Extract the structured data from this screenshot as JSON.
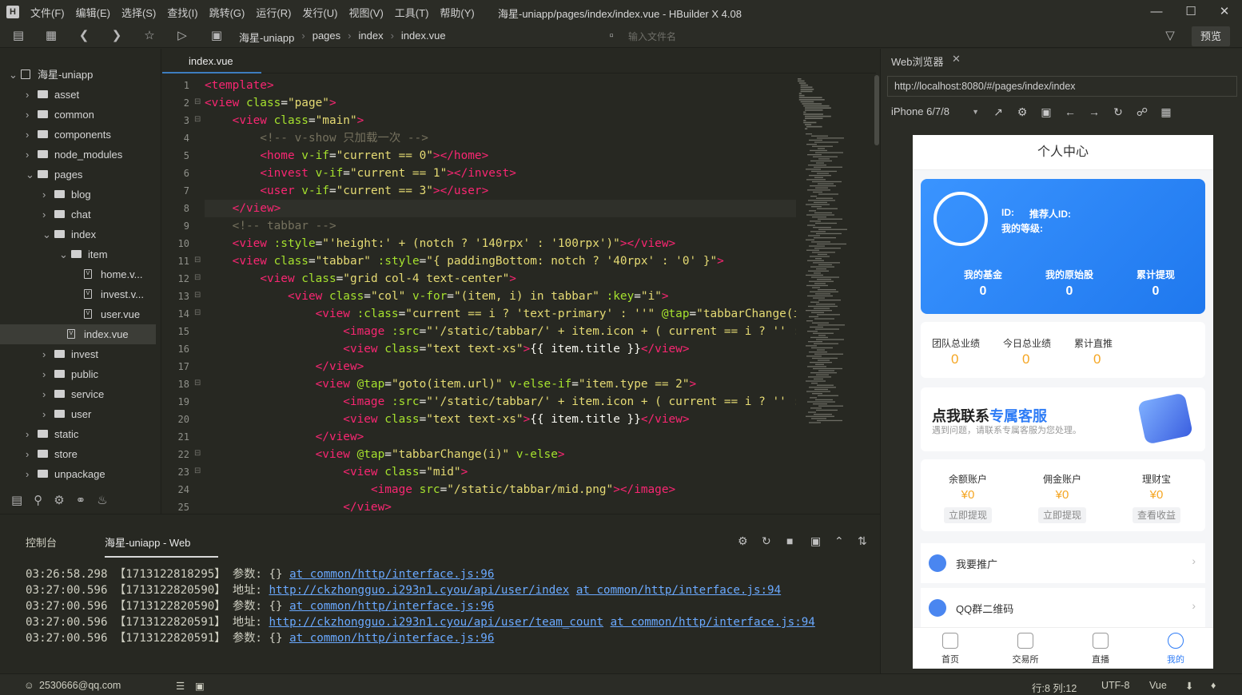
{
  "app": {
    "logo": "H",
    "title": "海星-uniapp/pages/index/index.vue - HBuilder X 4.08"
  },
  "menu": [
    "文件(F)",
    "编辑(E)",
    "选择(S)",
    "查找(I)",
    "跳转(G)",
    "运行(R)",
    "发行(U)",
    "视图(V)",
    "工具(T)",
    "帮助(Y)"
  ],
  "breadcrumb": [
    "海星-uniapp",
    "pages",
    "index",
    "index.vue"
  ],
  "toolbar": {
    "file_search_placeholder": "输入文件名",
    "preview_label": "预览"
  },
  "tree": [
    {
      "label": "海星-uniapp",
      "depth": 0,
      "type": "project",
      "state": "open"
    },
    {
      "label": "asset",
      "depth": 1,
      "type": "folder",
      "state": "closed"
    },
    {
      "label": "common",
      "depth": 1,
      "type": "folder",
      "state": "closed"
    },
    {
      "label": "components",
      "depth": 1,
      "type": "folder",
      "state": "closed"
    },
    {
      "label": "node_modules",
      "depth": 1,
      "type": "folder",
      "state": "closed"
    },
    {
      "label": "pages",
      "depth": 1,
      "type": "folder",
      "state": "open"
    },
    {
      "label": "blog",
      "depth": 2,
      "type": "folder",
      "state": "closed"
    },
    {
      "label": "chat",
      "depth": 2,
      "type": "folder",
      "state": "closed"
    },
    {
      "label": "index",
      "depth": 2,
      "type": "folder",
      "state": "open"
    },
    {
      "label": "item",
      "depth": 3,
      "type": "folder",
      "state": "open"
    },
    {
      "label": "home.v...",
      "depth": 4,
      "type": "file",
      "state": ""
    },
    {
      "label": "invest.v...",
      "depth": 4,
      "type": "file",
      "state": ""
    },
    {
      "label": "user.vue",
      "depth": 4,
      "type": "file",
      "state": ""
    },
    {
      "label": "index.vue",
      "depth": 3,
      "type": "file",
      "state": "selected"
    },
    {
      "label": "invest",
      "depth": 2,
      "type": "folder",
      "state": "closed"
    },
    {
      "label": "public",
      "depth": 2,
      "type": "folder",
      "state": "closed"
    },
    {
      "label": "service",
      "depth": 2,
      "type": "folder",
      "state": "closed"
    },
    {
      "label": "user",
      "depth": 2,
      "type": "folder",
      "state": "closed"
    },
    {
      "label": "static",
      "depth": 1,
      "type": "folder",
      "state": "closed"
    },
    {
      "label": "store",
      "depth": 1,
      "type": "folder",
      "state": "closed"
    },
    {
      "label": "unpackage",
      "depth": 1,
      "type": "folder",
      "state": "closed"
    }
  ],
  "editor": {
    "tab": "index.vue",
    "lines": [
      [
        [
          "t",
          "<template"
        ],
        [
          "t",
          ">"
        ]
      ],
      [
        [
          "t",
          "<view "
        ],
        [
          "a",
          "class"
        ],
        [
          "p",
          "="
        ],
        [
          "s",
          "\"page\""
        ],
        [
          "t",
          ">"
        ]
      ],
      [
        [
          "p",
          "    "
        ],
        [
          "t",
          "<view "
        ],
        [
          "a",
          "class"
        ],
        [
          "p",
          "="
        ],
        [
          "s",
          "\"main\""
        ],
        [
          "t",
          ">"
        ]
      ],
      [
        [
          "c",
          "        <!-- v-show 只加载一次 -->"
        ]
      ],
      [
        [
          "p",
          "        "
        ],
        [
          "t",
          "<home "
        ],
        [
          "a",
          "v-if"
        ],
        [
          "p",
          "="
        ],
        [
          "s",
          "\"current == 0\""
        ],
        [
          "t",
          "></home>"
        ]
      ],
      [
        [
          "p",
          "        "
        ],
        [
          "t",
          "<invest "
        ],
        [
          "a",
          "v-if"
        ],
        [
          "p",
          "="
        ],
        [
          "s",
          "\"current == 1\""
        ],
        [
          "t",
          "></invest>"
        ]
      ],
      [
        [
          "p",
          "        "
        ],
        [
          "t",
          "<user "
        ],
        [
          "a",
          "v-if"
        ],
        [
          "p",
          "="
        ],
        [
          "s",
          "\"current == 3\""
        ],
        [
          "t",
          "></user>"
        ]
      ],
      [
        [
          "p",
          "    "
        ],
        [
          "t",
          "</view>"
        ]
      ],
      [
        [
          "c",
          "    <!-- tabbar -->"
        ]
      ],
      [
        [
          "p",
          "    "
        ],
        [
          "t",
          "<view "
        ],
        [
          "a",
          ":style"
        ],
        [
          "p",
          "="
        ],
        [
          "s",
          "\"'height:' + (notch ? '140rpx' : '100rpx')\""
        ],
        [
          "t",
          "></view>"
        ]
      ],
      [
        [
          "p",
          "    "
        ],
        [
          "t",
          "<view "
        ],
        [
          "a",
          "class"
        ],
        [
          "p",
          "="
        ],
        [
          "s",
          "\"tabbar\""
        ],
        [
          "p",
          " "
        ],
        [
          "a",
          ":style"
        ],
        [
          "p",
          "="
        ],
        [
          "s",
          "\"{ paddingBottom: notch ? '40rpx' : '0' }\""
        ],
        [
          "t",
          ">"
        ]
      ],
      [
        [
          "p",
          "        "
        ],
        [
          "t",
          "<view "
        ],
        [
          "a",
          "class"
        ],
        [
          "p",
          "="
        ],
        [
          "s",
          "\"grid col-4 text-center\""
        ],
        [
          "t",
          ">"
        ]
      ],
      [
        [
          "p",
          "            "
        ],
        [
          "t",
          "<view "
        ],
        [
          "a",
          "class"
        ],
        [
          "p",
          "="
        ],
        [
          "s",
          "\"col\""
        ],
        [
          "p",
          " "
        ],
        [
          "a",
          "v-for"
        ],
        [
          "p",
          "="
        ],
        [
          "s",
          "\"(item, i) in tabbar\""
        ],
        [
          "p",
          " "
        ],
        [
          "a",
          ":key"
        ],
        [
          "p",
          "="
        ],
        [
          "s",
          "\"i\""
        ],
        [
          "t",
          ">"
        ]
      ],
      [
        [
          "p",
          "                "
        ],
        [
          "t",
          "<view "
        ],
        [
          "a",
          ":class"
        ],
        [
          "p",
          "="
        ],
        [
          "s",
          "\"current == i ? 'text-primary' : ''\""
        ],
        [
          "p",
          " "
        ],
        [
          "a",
          "@tap"
        ],
        [
          "p",
          "="
        ],
        [
          "s",
          "\"tabbarChange(i)\""
        ]
      ],
      [
        [
          "p",
          "                    "
        ],
        [
          "t",
          "<image "
        ],
        [
          "a",
          ":src"
        ],
        [
          "p",
          "="
        ],
        [
          "s",
          "\"'/static/tabbar/' + item.icon + ( current == i ? '' : '-n')\""
        ]
      ],
      [
        [
          "p",
          "                    "
        ],
        [
          "t",
          "<view "
        ],
        [
          "a",
          "class"
        ],
        [
          "p",
          "="
        ],
        [
          "s",
          "\"text text-xs\""
        ],
        [
          "t",
          ">"
        ],
        [
          "p",
          "{{ item.title }}"
        ],
        [
          "t",
          "</view>"
        ]
      ],
      [
        [
          "p",
          "                "
        ],
        [
          "t",
          "</view>"
        ]
      ],
      [
        [
          "p",
          "                "
        ],
        [
          "t",
          "<view "
        ],
        [
          "a",
          "@tap"
        ],
        [
          "p",
          "="
        ],
        [
          "s",
          "\"goto(item.url)\""
        ],
        [
          "p",
          " "
        ],
        [
          "a",
          "v-else-if"
        ],
        [
          "p",
          "="
        ],
        [
          "s",
          "\"item.type == 2\""
        ],
        [
          "t",
          ">"
        ]
      ],
      [
        [
          "p",
          "                    "
        ],
        [
          "t",
          "<image "
        ],
        [
          "a",
          ":src"
        ],
        [
          "p",
          "="
        ],
        [
          "s",
          "\"'/static/tabbar/' + item.icon + ( current == i ? '' : '-n')\""
        ]
      ],
      [
        [
          "p",
          "                    "
        ],
        [
          "t",
          "<view "
        ],
        [
          "a",
          "class"
        ],
        [
          "p",
          "="
        ],
        [
          "s",
          "\"text text-xs\""
        ],
        [
          "t",
          ">"
        ],
        [
          "p",
          "{{ item.title }}"
        ],
        [
          "t",
          "</view>"
        ]
      ],
      [
        [
          "p",
          "                "
        ],
        [
          "t",
          "</view>"
        ]
      ],
      [
        [
          "p",
          "                "
        ],
        [
          "t",
          "<view "
        ],
        [
          "a",
          "@tap"
        ],
        [
          "p",
          "="
        ],
        [
          "s",
          "\"tabbarChange(i)\""
        ],
        [
          "p",
          " "
        ],
        [
          "a",
          "v-else"
        ],
        [
          "t",
          ">"
        ]
      ],
      [
        [
          "p",
          "                    "
        ],
        [
          "t",
          "<view "
        ],
        [
          "a",
          "class"
        ],
        [
          "p",
          "="
        ],
        [
          "s",
          "\"mid\""
        ],
        [
          "t",
          ">"
        ]
      ],
      [
        [
          "p",
          "                        "
        ],
        [
          "t",
          "<image "
        ],
        [
          "a",
          "src"
        ],
        [
          "p",
          "="
        ],
        [
          "s",
          "\"/static/tabbar/mid.png\""
        ],
        [
          "t",
          "></image>"
        ]
      ],
      [
        [
          "p",
          "                    "
        ],
        [
          "t",
          "</view>"
        ]
      ]
    ]
  },
  "browser": {
    "tab_label": "Web浏览器",
    "url": "http://localhost:8080/#/pages/index/index",
    "device": "iPhone 6/7/8"
  },
  "phone": {
    "header": "个人中心",
    "id_label": "ID:",
    "referrer_label": "推荐人ID:",
    "level_label": "我的等级:",
    "stats": [
      {
        "label": "我的基金",
        "value": "0"
      },
      {
        "label": "我的原始股",
        "value": "0"
      },
      {
        "label": "累计提现",
        "value": "0"
      }
    ],
    "performance": [
      {
        "label": "团队总业绩",
        "value": "0"
      },
      {
        "label": "今日总业绩",
        "value": "0"
      },
      {
        "label": "累计直推",
        "value": "0"
      }
    ],
    "service": {
      "title_a": "点我联系",
      "title_b": "专属客服",
      "subtitle": "遇到问题，请联系专属客服为您处理。"
    },
    "accounts": [
      {
        "label": "余额账户",
        "value": "¥0",
        "button": "立即提现"
      },
      {
        "label": "佣金账户",
        "value": "¥0",
        "button": "立即提现"
      },
      {
        "label": "理财宝",
        "value": "¥0",
        "button": "查看收益"
      }
    ],
    "list": [
      {
        "label": "我要推广"
      },
      {
        "label": "QQ群二维码"
      }
    ],
    "tabbar": [
      {
        "label": "首页",
        "active": false
      },
      {
        "label": "交易所",
        "active": false
      },
      {
        "label": "直播",
        "active": false
      },
      {
        "label": "我的",
        "active": true
      }
    ],
    "accent_color": "#2e7cf6"
  },
  "console": {
    "tabs": [
      "控制台",
      "海星-uniapp - Web"
    ],
    "lines": [
      {
        "time": "03:26:58.298",
        "id": "【1713122818295】",
        "kind": "参数:",
        "val": " {} ",
        "url": "",
        "src": "at common/http/interface.js:96"
      },
      {
        "time": "03:27:00.596",
        "id": "【1713122820590】",
        "kind": "地址:",
        "val": " ",
        "url": "http://ckzhongguo.i293n1.cyou/api/user/index",
        "src": "at common/http/interface.js:94"
      },
      {
        "time": "03:27:00.596",
        "id": "【1713122820590】",
        "kind": "参数:",
        "val": " {} ",
        "url": "",
        "src": "at common/http/interface.js:96"
      },
      {
        "time": "03:27:00.596",
        "id": "【1713122820591】",
        "kind": "地址:",
        "val": " ",
        "url": "http://ckzhongguo.i293n1.cyou/api/user/team_count",
        "src": "at common/http/interface.js:94"
      },
      {
        "time": "03:27:00.596",
        "id": "【1713122820591】",
        "kind": "参数:",
        "val": " {} ",
        "url": "",
        "src": "at common/http/interface.js:96"
      }
    ]
  },
  "status": {
    "user": "2530666@qq.com",
    "position": "行:8  列:12",
    "encoding": "UTF-8",
    "language": "Vue"
  }
}
